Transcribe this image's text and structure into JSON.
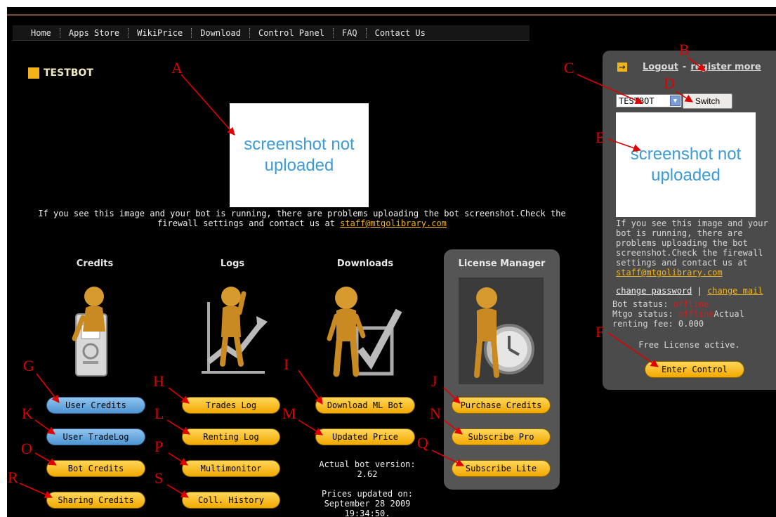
{
  "nav": {
    "items": [
      "Home",
      "Apps Store",
      "WikiPrice",
      "Download",
      "Control Panel",
      "FAQ",
      "Contact Us"
    ]
  },
  "bot_title": "TESTBOT",
  "main": {
    "screenshot_text": "screenshot not uploaded",
    "warning": "If you see this image and your bot is running, there are problems uploading the bot screenshot.Check the firewall settings and contact us at",
    "email": "staff@mtgolibrary.com"
  },
  "columns": {
    "credits": "Credits",
    "logs": "Logs",
    "downloads": "Downloads",
    "license": "License Manager"
  },
  "buttons": {
    "user_credits": "User Credits",
    "user_tradelog": "User TradeLog",
    "bot_credits": "Bot Credits",
    "sharing_credits": "Sharing Credits",
    "trades_log": "Trades Log",
    "renting_log": "Renting Log",
    "multimonitor": "Multimonitor",
    "coll_history": "Coll. History",
    "download_ml_bot": "Download ML Bot",
    "updated_price": "Updated Price",
    "purchase_credits": "Purchase Credits",
    "subscribe_pro": "Subscribe Pro",
    "subscribe_lite": "Subscribe Lite",
    "enter_control": "Enter Control"
  },
  "info": {
    "version_label": "Actual bot version:",
    "version": "2.62",
    "prices_label": "Prices updated on:",
    "prices_date": "September 28 2009",
    "prices_time": "19:34:50."
  },
  "sidebar": {
    "logout": "Logout",
    "dash": " - ",
    "register": "register more",
    "select_value": "TESTBOT",
    "switch_label": "Switch",
    "screenshot_text": "screenshot not uploaded",
    "warning": "If you see this image and your bot is running, there are problems uploading the bot screenshot.Check the firewall settings and contact us at",
    "email": "staff@mtgolibrary.com",
    "change_password": "change password",
    "sep": " | ",
    "change_mail": "change mail",
    "bot_status_label": "Bot status:",
    "bot_status": "offline",
    "mtgo_status_label": "Mtgo status:",
    "mtgo_status": "offline",
    "renting_fee": "Actual renting fee: 0.000",
    "free_license": "Free License active."
  },
  "annotations": [
    "A",
    "B",
    "C",
    "D",
    "E",
    "F",
    "G",
    "H",
    "I",
    "J",
    "K",
    "L",
    "M",
    "N",
    "O",
    "P",
    "Q",
    "R",
    "S"
  ],
  "colors": {
    "background": "#000000",
    "accent_yellow": "#f2b318",
    "button_blue": "#4e95d3",
    "offline_red": "#d02020",
    "link_yellow": "#f2b318",
    "annotation_red": "#e00000"
  }
}
